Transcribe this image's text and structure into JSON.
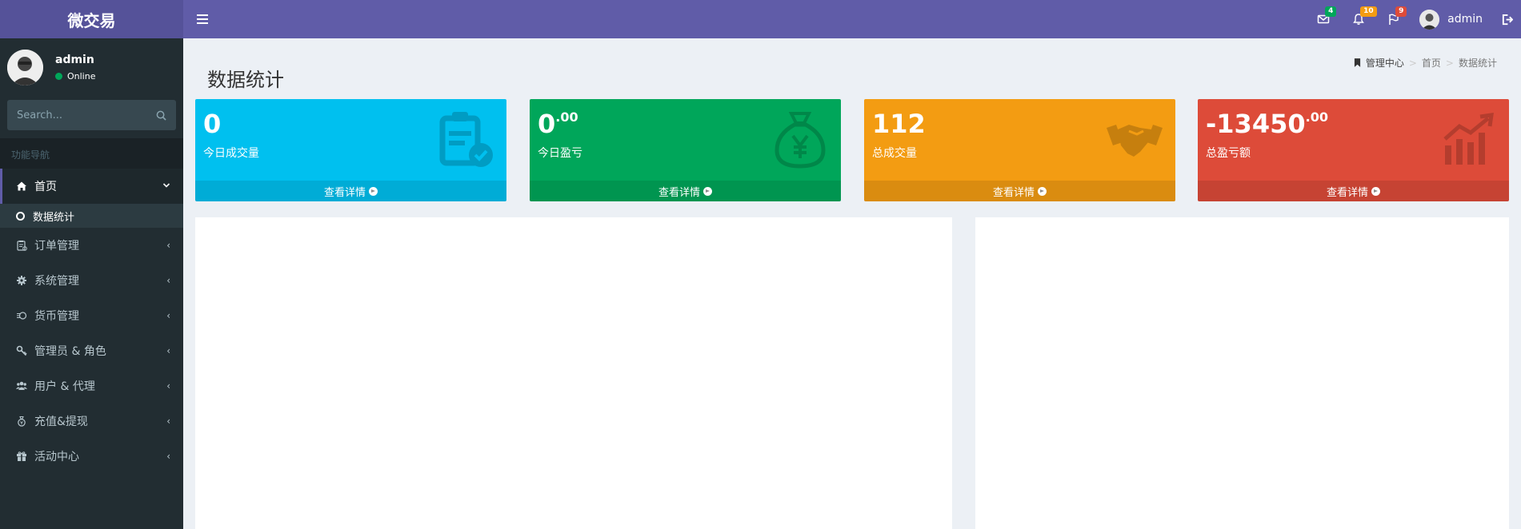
{
  "app": {
    "logo": "微交易"
  },
  "header": {
    "mail_count": "4",
    "bell_count": "10",
    "flag_count": "9",
    "user": "admin",
    "colors": {
      "mail_badge": "#00a65a",
      "bell_badge": "#f39c12",
      "flag_badge": "#dd4b39"
    }
  },
  "sidebar": {
    "user": {
      "name": "admin",
      "status": "Online"
    },
    "search": {
      "placeholder": "Search..."
    },
    "section": "功能导航",
    "items": [
      {
        "label": "首页",
        "icon": "home-icon",
        "expanded": true
      },
      {
        "label": "订单管理",
        "icon": "clipboard-icon"
      },
      {
        "label": "系统管理",
        "icon": "gear-icon"
      },
      {
        "label": "货币管理",
        "icon": "currency-icon"
      },
      {
        "label": "管理员 & 角色",
        "icon": "key-icon"
      },
      {
        "label": "用户 & 代理",
        "icon": "users-icon"
      },
      {
        "label": "充值&提现",
        "icon": "money-bag-icon"
      },
      {
        "label": "活动中心",
        "icon": "gift-icon"
      }
    ],
    "subitems": [
      {
        "label": "数据统计"
      }
    ]
  },
  "content": {
    "title": "数据统计",
    "breadcrumb": [
      "管理中心",
      "首页",
      "数据统计"
    ]
  },
  "boxes": [
    {
      "value": "0",
      "sup": "",
      "label": "今日成交量",
      "footer": "查看详情",
      "color": "#00c0ef",
      "icon": "clipboard-check-icon"
    },
    {
      "value": "0",
      "sup": ".00",
      "label": "今日盈亏",
      "footer": "查看详情",
      "color": "#00a65a",
      "icon": "money-bag-icon"
    },
    {
      "value": "112",
      "sup": "",
      "label": "总成交量",
      "footer": "查看详情",
      "color": "#f39c12",
      "icon": "handshake-icon"
    },
    {
      "value": "-13450",
      "sup": ".00",
      "label": "总盈亏额",
      "footer": "查看详情",
      "color": "#dd4b39",
      "icon": "chart-up-icon"
    }
  ]
}
